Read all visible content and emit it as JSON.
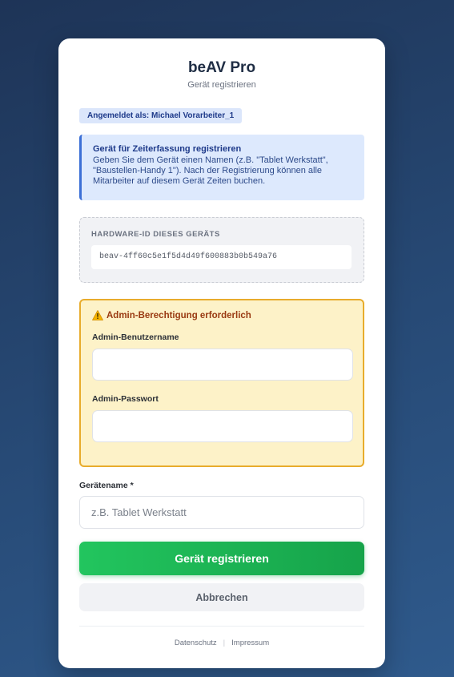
{
  "app": {
    "title": "beAV Pro",
    "subtitle": "Gerät registrieren"
  },
  "user_badge": "Angemeldet als: Michael Vorarbeiter_1",
  "info": {
    "title": "Gerät für Zeiterfassung registrieren",
    "text": "Geben Sie dem Gerät einen Namen (z.B. \"Tablet Werkstatt\", \"Baustellen-Handy 1\"). Nach der Registrierung können alle Mitarbeiter auf diesem Gerät Zeiten buchen."
  },
  "hardware": {
    "label": "HARDWARE-ID DIESES GERÄTS",
    "value": "beav-4ff60c5e1f5d4d49f600883b0b549a76"
  },
  "admin": {
    "heading": "Admin-Berechtigung erforderlich",
    "warning_icon": "warning-icon",
    "username_label": "Admin-Benutzername",
    "username_value": "",
    "password_label": "Admin-Passwort",
    "password_value": ""
  },
  "device": {
    "label": "Gerätename *",
    "placeholder": "z.B. Tablet Werkstatt",
    "value": ""
  },
  "buttons": {
    "register": "Gerät registrieren",
    "cancel": "Abbrechen"
  },
  "footer": {
    "privacy": "Datenschutz",
    "separator": "|",
    "imprint": "Impressum"
  },
  "colors": {
    "primary": "#22c55e",
    "info_accent": "#3b6fd6",
    "warning_border": "#e8ac2c",
    "warning_bg": "#fdf2c8",
    "background": "#274a76"
  }
}
